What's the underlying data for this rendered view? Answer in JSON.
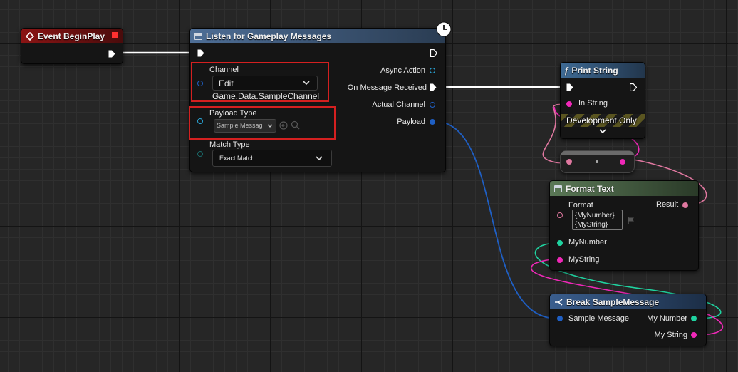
{
  "colors": {
    "exec": "#ffffff",
    "struct": "#1f5fc4",
    "string": "#f028b8",
    "integer": "#1fd3a0",
    "text": "#e078a0",
    "gameplay_tag": "#1a6a6a",
    "event_header": "#6e1212",
    "function_header": "#2b4566",
    "pure_header": "#3c5a3a",
    "break_header": "#26466e",
    "red_highlight": "#d42020"
  },
  "event_begin_play": {
    "title": "Event BeginPlay",
    "icon": "event-diamond-icon"
  },
  "listen_node": {
    "title": "Listen for Gameplay Messages",
    "icon": "function-icon",
    "latent_icon": "clock-icon",
    "channel": {
      "label": "Channel",
      "dropdown_value": "Edit",
      "tag_value": "Game.Data.SampleChannel"
    },
    "payload_type": {
      "label": "Payload Type",
      "dropdown_value": "Sample Messag",
      "browse_icon": "arrow-left-circle-icon",
      "search_icon": "search-icon"
    },
    "match_type": {
      "label": "Match Type",
      "dropdown_value": "Exact Match"
    },
    "outputs": {
      "async_action": "Async Action",
      "on_message_received": "On Message Received",
      "actual_channel": "Actual Channel",
      "payload": "Payload"
    }
  },
  "print_string": {
    "title": "Print String",
    "icon": "function-f-icon",
    "in_string": "In String",
    "dev_only": "Development Only",
    "expand_icon": "chevron-down-icon"
  },
  "reroute": {
    "label": ""
  },
  "format_text": {
    "title": "Format Text",
    "format_label": "Format",
    "format_value_line1": "{MyNumber}",
    "format_value_line2": "{MyString}",
    "flag_icon": "flag-icon",
    "result": "Result",
    "my_number": "MyNumber",
    "my_string": "MyString"
  },
  "break_message": {
    "title": "Break SampleMessage",
    "icon": "break-struct-icon",
    "input": "Sample Message",
    "out_number": "My Number",
    "out_string": "My String"
  }
}
